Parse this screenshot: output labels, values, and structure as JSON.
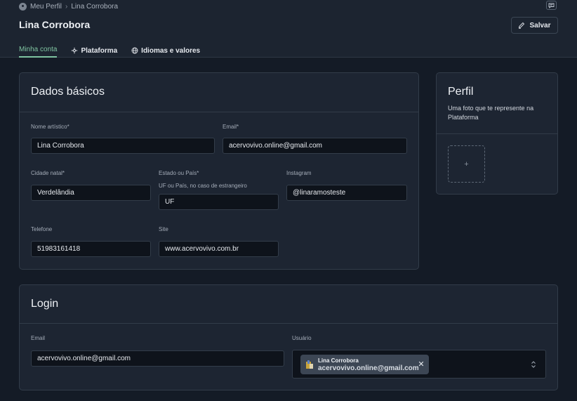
{
  "breadcrumb": {
    "root": "Meu Perfil",
    "current": "Lina Corrobora"
  },
  "header": {
    "title": "Lina Corrobora",
    "save_label": "Salvar"
  },
  "tabs": [
    {
      "label": "Minha conta",
      "icon": "none",
      "active": true
    },
    {
      "label": "Plataforma",
      "icon": "platform-icon",
      "active": false
    },
    {
      "label": "Idiomas e valores",
      "icon": "globe-icon",
      "active": false
    }
  ],
  "basic": {
    "title": "Dados básicos",
    "artist_name": {
      "label": "Nome artístico*",
      "value": "Lina Corrobora"
    },
    "email": {
      "label": "Email*",
      "value": "acervovivo.online@gmail.com"
    },
    "city": {
      "label": "Cidade natal*",
      "value": "Verdelândia"
    },
    "state": {
      "label": "Estado ou País*",
      "hint": "UF ou País, no caso de estrangeiro",
      "value": "UF"
    },
    "instagram": {
      "label": "Instagram",
      "value": "@linaramosteste"
    },
    "phone": {
      "label": "Telefone",
      "value": "51983161418"
    },
    "site": {
      "label": "Site",
      "value": "www.acervovivo.com.br"
    }
  },
  "profile": {
    "title": "Perfil",
    "description": "Uma foto que te represente na Plataforma",
    "add_symbol": "+"
  },
  "login": {
    "title": "Login",
    "email": {
      "label": "Email",
      "value": "acervovivo.online@gmail.com"
    },
    "user": {
      "label": "Usuário",
      "chip_name": "Lina Corrobora",
      "chip_email": "acervovivo.online@gmail.com",
      "close_symbol": "✕"
    }
  },
  "colors": {
    "accent": "#7fc3a1",
    "background": "#141b26",
    "card": "#1d2532",
    "field": "#0e131b"
  }
}
